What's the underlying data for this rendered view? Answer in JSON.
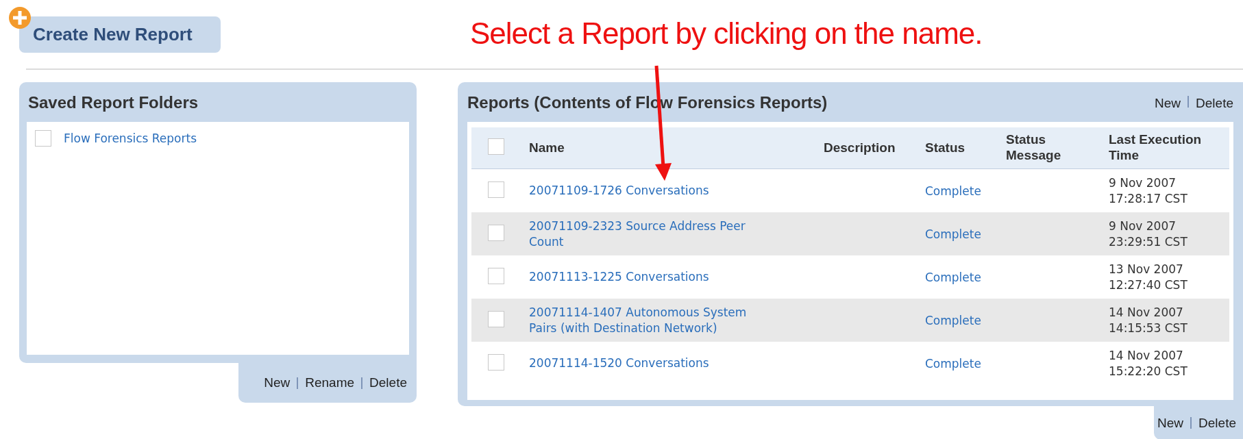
{
  "create_button": {
    "label": "Create New Report"
  },
  "annotation": {
    "text": "Select a Report by clicking on the name."
  },
  "folders_panel": {
    "title": "Saved Report Folders",
    "items": [
      {
        "name": "Flow Forensics Reports",
        "checked": false
      }
    ],
    "actions": [
      "New",
      "Rename",
      "Delete"
    ]
  },
  "reports_panel": {
    "title": "Reports (Contents of Flow Forensics Reports)",
    "top_actions": [
      "New",
      "Delete"
    ],
    "select_all_checked": false,
    "columns": [
      "Name",
      "Description",
      "Status",
      "Status Message",
      "Last Execution Time"
    ],
    "rows": [
      {
        "name": "20071109-1726 Conversations",
        "status": "Complete",
        "last_execution": "9 Nov 2007 17:28:17 CST",
        "checked": false
      },
      {
        "name": "20071109-2323 Source Address Peer Count",
        "status": "Complete",
        "last_execution": "9 Nov 2007 23:29:51 CST",
        "checked": false
      },
      {
        "name": "20071113-1225 Conversations",
        "status": "Complete",
        "last_execution": "13 Nov 2007 12:27:40 CST",
        "checked": false
      },
      {
        "name": "20071114-1407 Autonomous System Pairs (with Destination Network)",
        "status": "Complete",
        "last_execution": "14 Nov 2007 14:15:53 CST",
        "checked": false
      },
      {
        "name": "20071114-1520 Conversations",
        "status": "Complete",
        "last_execution": "14 Nov 2007 15:22:20 CST",
        "checked": false
      }
    ],
    "bottom_actions": [
      "New",
      "Delete"
    ]
  }
}
